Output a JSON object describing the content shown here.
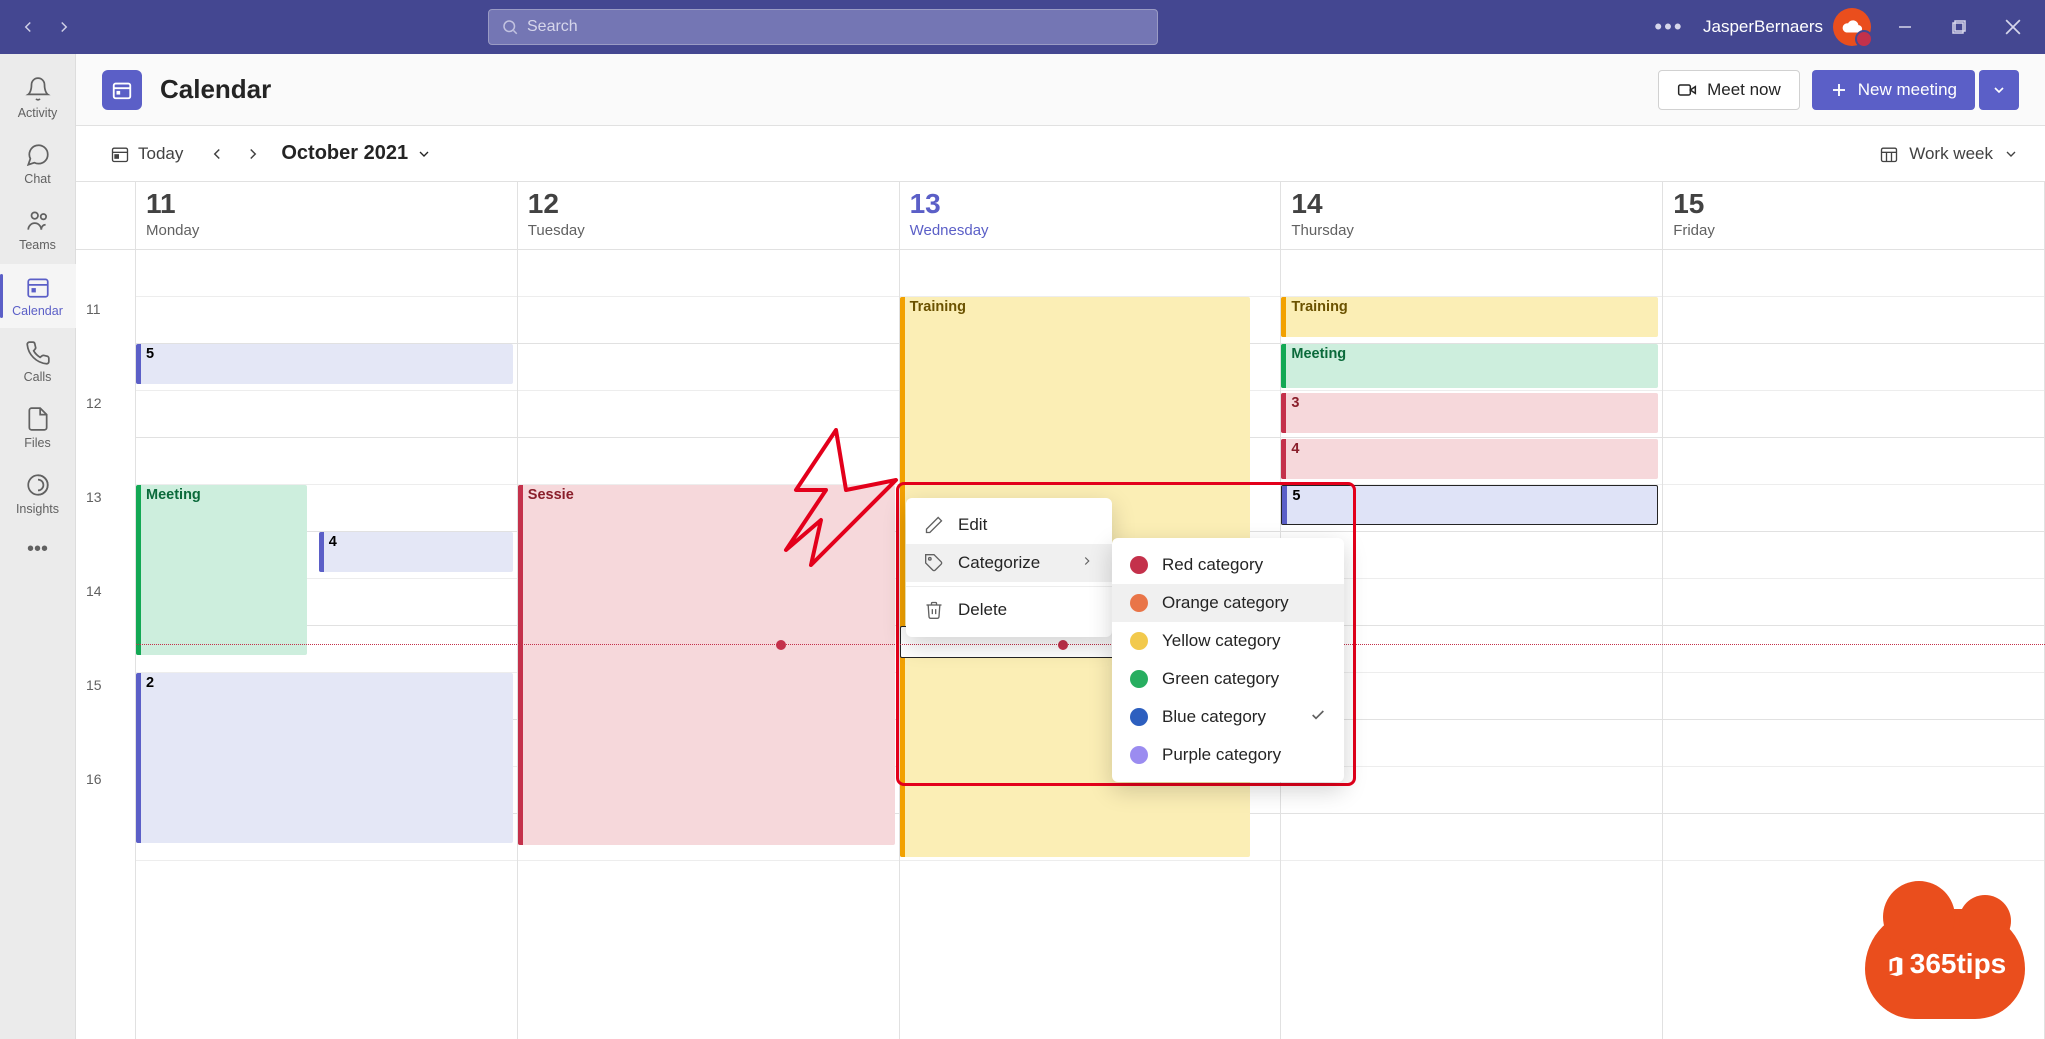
{
  "titlebar": {
    "search_placeholder": "Search",
    "username": "JasperBernaers"
  },
  "rail": {
    "items": [
      {
        "label": "Activity",
        "icon": "bell"
      },
      {
        "label": "Chat",
        "icon": "chat"
      },
      {
        "label": "Teams",
        "icon": "teams"
      },
      {
        "label": "Calendar",
        "icon": "calendar",
        "active": true
      },
      {
        "label": "Calls",
        "icon": "calls"
      },
      {
        "label": "Files",
        "icon": "files"
      },
      {
        "label": "Insights",
        "icon": "insights"
      }
    ]
  },
  "header": {
    "title": "Calendar",
    "meet_now": "Meet now",
    "new_meeting": "New meeting"
  },
  "toolbar": {
    "today": "Today",
    "month": "October 2021",
    "view": "Work week"
  },
  "days": [
    {
      "num": "11",
      "dow": "Monday"
    },
    {
      "num": "12",
      "dow": "Tuesday"
    },
    {
      "num": "13",
      "dow": "Wednesday",
      "today": true
    },
    {
      "num": "14",
      "dow": "Thursday"
    },
    {
      "num": "15",
      "dow": "Friday"
    }
  ],
  "hours": [
    "11",
    "12",
    "13",
    "14",
    "15",
    "16"
  ],
  "events": {
    "mon_5": "5",
    "mon_meeting": "Meeting",
    "mon_4": "4",
    "mon_2": "2",
    "tue_sessie": "Sessie",
    "wed_training": "Training",
    "thu_training": "Training",
    "thu_meeting": "Meeting",
    "thu_3": "3",
    "thu_4": "4",
    "thu_5": "5"
  },
  "context_menu": {
    "edit": "Edit",
    "categorize": "Categorize",
    "delete": "Delete"
  },
  "categories": [
    {
      "label": "Red category",
      "color": "#c4314b"
    },
    {
      "label": "Orange category",
      "color": "#e97548",
      "selected_row": true
    },
    {
      "label": "Yellow category",
      "color": "#f2c94c"
    },
    {
      "label": "Green category",
      "color": "#27ae60"
    },
    {
      "label": "Blue category",
      "color": "#2d5fbf",
      "checked": true
    },
    {
      "label": "Purple category",
      "color": "#9b8cf0"
    }
  ],
  "watermark": "365tips"
}
